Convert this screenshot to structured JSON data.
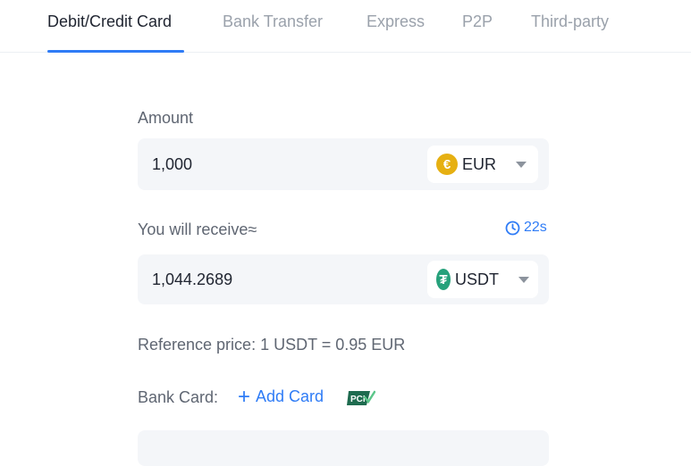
{
  "tabs": [
    {
      "label": "Debit/Credit Card",
      "active": true
    },
    {
      "label": "Bank Transfer",
      "active": false
    },
    {
      "label": "Express",
      "active": false
    },
    {
      "label": "P2P",
      "active": false
    },
    {
      "label": "Third-party",
      "active": false
    }
  ],
  "amount": {
    "label": "Amount",
    "value": "1,000",
    "currency": {
      "code": "EUR",
      "icon": "euro-coin-icon",
      "symbol": "€",
      "color": "#e6b012"
    }
  },
  "receive": {
    "label": "You will receive≈",
    "timer": "22s",
    "value": "1,044.2689",
    "currency": {
      "code": "USDT",
      "icon": "tether-coin-icon",
      "symbol": "₮",
      "color": "#26a17b"
    }
  },
  "reference": {
    "text": "Reference price: 1 USDT = 0.95 EUR"
  },
  "bank_card": {
    "label": "Bank Card:",
    "add_label": "Add Card",
    "badge": "PCI"
  },
  "colors": {
    "accent": "#2f7cf6",
    "field_bg": "#f4f6f9",
    "muted_text": "#9aa1ab"
  }
}
